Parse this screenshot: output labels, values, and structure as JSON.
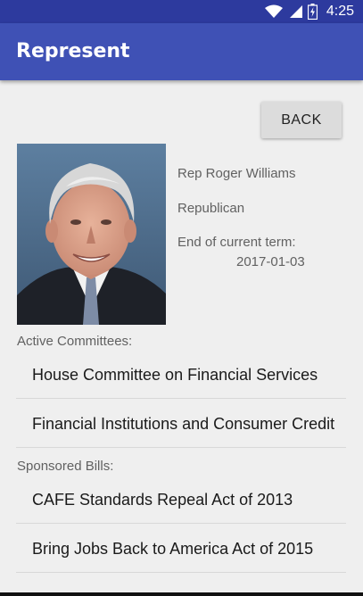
{
  "status_bar": {
    "time": "4:25",
    "icons": [
      "wifi-icon",
      "signal-icon",
      "battery-icon"
    ]
  },
  "app_bar": {
    "title": "Represent",
    "color": "#3f51b5"
  },
  "back_button": {
    "label": "BACK"
  },
  "representative": {
    "photo_alt": "Representative portrait",
    "name": "Rep Roger Williams",
    "party": "Republican",
    "term_label": "End of current term:",
    "term_end": "2017-01-03"
  },
  "committees": {
    "label": "Active Committees:",
    "items": [
      "House Committee on Financial Services",
      "Financial Institutions and Consumer Credit"
    ]
  },
  "bills": {
    "label": "Sponsored Bills:",
    "items": [
      "CAFE Standards Repeal Act of 2013",
      "Bring Jobs Back to America Act of 2015"
    ]
  }
}
